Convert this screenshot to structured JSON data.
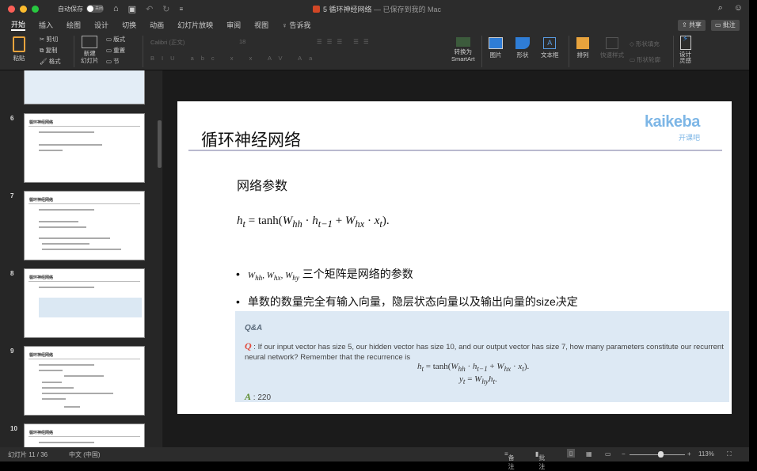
{
  "titlebar": {
    "autosave_label": "自动保存",
    "autosave_state": "关闭",
    "document_title": "5 循环神经网络",
    "save_status": "— 已保存到我的 Mac"
  },
  "tabs": [
    "开始",
    "插入",
    "绘图",
    "设计",
    "切换",
    "动画",
    "幻灯片放映",
    "审阅",
    "视图",
    "告诉我"
  ],
  "buttons": {
    "share": "共享",
    "comments": "批注"
  },
  "ribbon": {
    "paste": "粘贴",
    "cut": "剪切",
    "copy": "复制",
    "format": "格式",
    "new_slide": "新建\n幻灯片",
    "layout": "版式",
    "reset": "重置",
    "section": "节",
    "font_name": "Calibri (正文)",
    "font_size": "18",
    "convert": "转换为",
    "smartart": "SmartArt",
    "picture": "图片",
    "shape": "形状",
    "textbox": "文本框",
    "arrange": "排列",
    "quick_styles": "快速样式",
    "shape_fill": "形状填充",
    "shape_outline": "形状轮廓",
    "design_ideas_1": "设计",
    "design_ideas_2": "灵感"
  },
  "thumbnails": [
    {
      "num": "6",
      "title": "循环神经网络"
    },
    {
      "num": "7",
      "title": "循环神经网络"
    },
    {
      "num": "8",
      "title": "循环神经网络"
    },
    {
      "num": "9",
      "title": "循环神经网络"
    },
    {
      "num": "10",
      "title": "循环神经网络"
    }
  ],
  "slide": {
    "title": "循环神经网络",
    "logo": "kaikeba",
    "logo_sub": "开课吧",
    "subtitle": "网络参数",
    "bullet1_text": "三个矩阵是网络的参数",
    "bullet2_text": "单数的数量完全有输入向量，隐层状态向量以及输出向量的size决定",
    "qa_header": "Q&A",
    "q_label": "Q",
    "question": "If our input vector has size 5, our hidden vector has size 10, and our output vector has size 7, how many parameters constitute our recurrent neural network? Remember that the recurrence is",
    "a_label": "A",
    "answer": "220"
  },
  "status": {
    "slide_info": "幻灯片 11 / 36",
    "language": "中文 (中国)",
    "notes": "备注",
    "comments": "批注",
    "zoom": "113%",
    "zoom_fraction": 0.55
  }
}
